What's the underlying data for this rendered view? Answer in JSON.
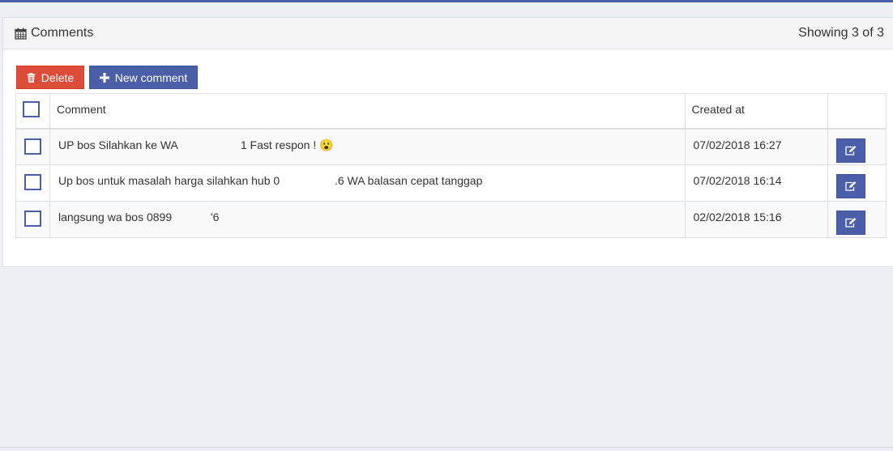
{
  "header": {
    "title": "Comments",
    "count_text": "Showing 3 of 3"
  },
  "toolbar": {
    "delete_label": "Delete",
    "new_label": "New comment"
  },
  "table": {
    "columns": [
      "Comment",
      "Created at"
    ],
    "rows": [
      {
        "comment": "UP bos Silahkan ke WA",
        "comment_end": "1  Fast respon ! 😮",
        "created_at": "07/02/2018 16:27"
      },
      {
        "comment": "Up bos untuk masalah harga silahkan hub 0",
        "comment_end": ".6 WA balasan cepat tanggap",
        "created_at": "07/02/2018 16:14"
      },
      {
        "comment": "langsung wa bos 0899",
        "comment_end": "'6",
        "created_at": "02/02/2018 15:16"
      }
    ]
  },
  "colors": {
    "primary": "#4a5fa8",
    "danger": "#dd4b39",
    "background": "#ecf0f5"
  }
}
